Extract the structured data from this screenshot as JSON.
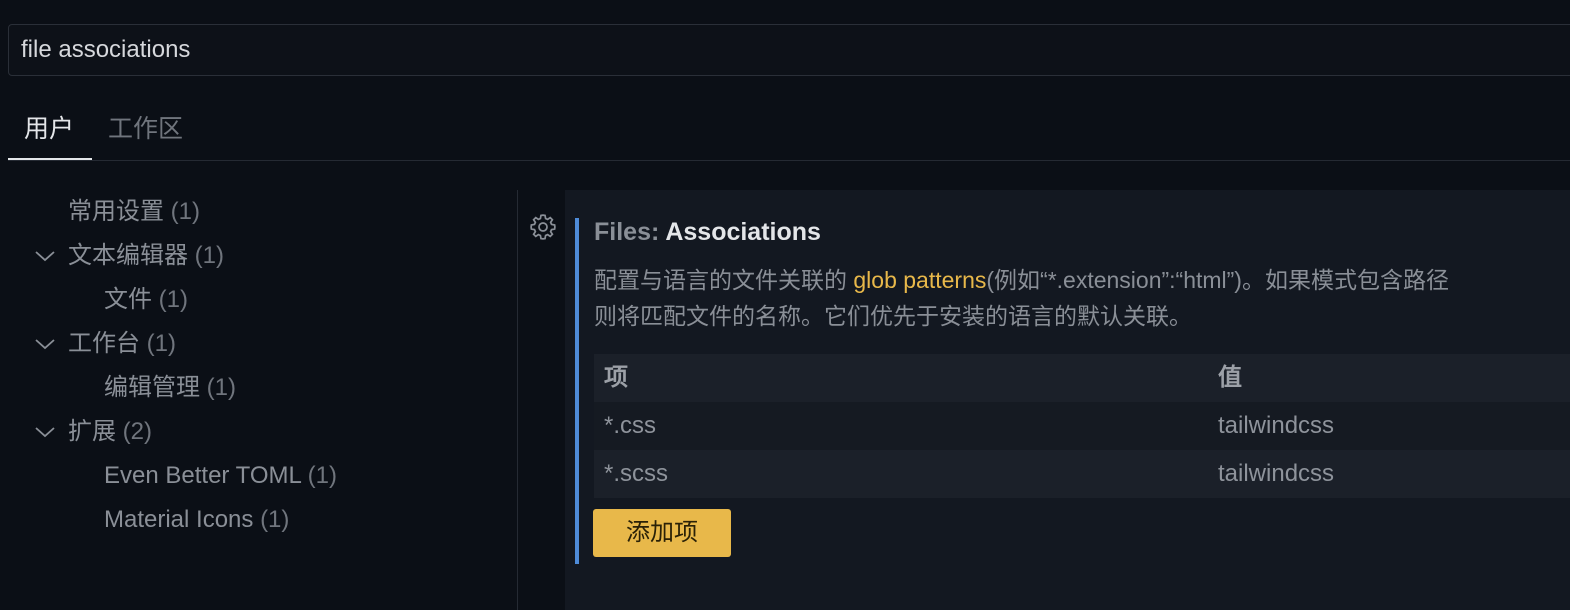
{
  "search": {
    "value": "file associations"
  },
  "tabs": [
    {
      "label": "用户"
    },
    {
      "label": "工作区"
    }
  ],
  "toc": [
    {
      "label": "常用设置",
      "count": "(1)",
      "expanded": null
    },
    {
      "label": "文本编辑器",
      "count": "(1)",
      "expanded": true
    },
    {
      "label": "文件",
      "count": "(1)",
      "expanded": null
    },
    {
      "label": "工作台",
      "count": "(1)",
      "expanded": true
    },
    {
      "label": "编辑管理",
      "count": "(1)",
      "expanded": null
    },
    {
      "label": "扩展",
      "count": "(2)",
      "expanded": true
    },
    {
      "label": "Even Better TOML",
      "count": "(1)",
      "expanded": null
    },
    {
      "label": "Material Icons",
      "count": "(1)",
      "expanded": null
    }
  ],
  "setting": {
    "category": "Files: ",
    "name": "Associations",
    "desc_before": "配置与语言的文件关联的 ",
    "desc_link": "glob patterns",
    "desc_after": "(例如“*.extension”:“html”)。如果模式包含路径",
    "desc_line2": "则将匹配文件的名称。它们优先于安装的语言的默认关联。",
    "table": {
      "headers": {
        "key": "项",
        "value": "值"
      },
      "rows": [
        {
          "key": "*.css",
          "value": "tailwindcss"
        },
        {
          "key": "*.scss",
          "value": "tailwindcss"
        }
      ]
    },
    "add_button": "添加项"
  },
  "icons": {
    "gear": "gear-icon",
    "chevron": "chevron-down-icon"
  },
  "colors": {
    "accent": "#e8b84a",
    "focus": "#4e8bd8",
    "background": "#0b0f16"
  }
}
